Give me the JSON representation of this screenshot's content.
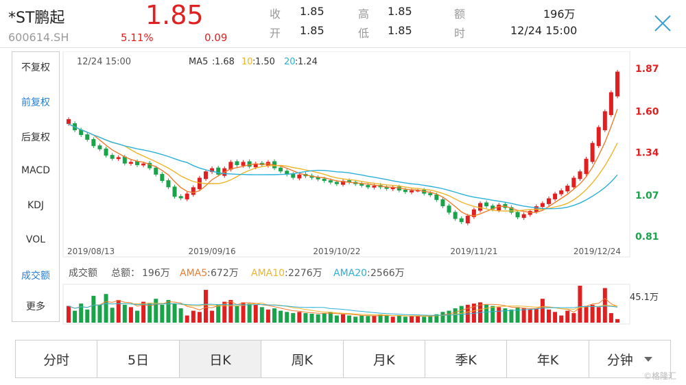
{
  "header": {
    "name": "*ST鹏起",
    "code": "600614.SH",
    "price": "1.85",
    "change_pct": "5.11%",
    "change_amt": "0.09",
    "quote": [
      {
        "label": "收",
        "value": "1.85"
      },
      {
        "label": "开",
        "value": "1.85"
      },
      {
        "label": "高",
        "value": "1.85"
      },
      {
        "label": "低",
        "value": "1.85"
      },
      {
        "label": "额",
        "value": "196万"
      },
      {
        "label": "时",
        "value": "12/24 15:00"
      }
    ]
  },
  "sidebar": {
    "items": [
      {
        "label": "不复权",
        "active": false
      },
      {
        "label": "前复权",
        "active": true
      },
      {
        "label": "后复权",
        "active": false
      },
      {
        "label": "MACD",
        "active": false
      },
      {
        "label": "KDJ",
        "active": false
      },
      {
        "label": "VOL",
        "active": false
      },
      {
        "label": "成交额",
        "active": true
      },
      {
        "label": "更多",
        "active": false
      }
    ]
  },
  "tabs": [
    {
      "label": "分时",
      "active": false
    },
    {
      "label": "5日",
      "active": false
    },
    {
      "label": "日K",
      "active": true
    },
    {
      "label": "周K",
      "active": false
    },
    {
      "label": "月K",
      "active": false
    },
    {
      "label": "季K",
      "active": false
    },
    {
      "label": "年K",
      "active": false
    },
    {
      "label": "分钟",
      "active": false,
      "dropdown": true
    }
  ],
  "colors": {
    "up": "#e02020",
    "down": "#1aa34a",
    "ma5": "#f07b2a",
    "ma10": "#f0b429",
    "ma20": "#2ab0d8",
    "active": "#2a7fd6"
  },
  "icons": {
    "close": "close-icon",
    "dropdown": "caret-down-icon"
  },
  "watermark": "©格隆汇",
  "chart_data": [
    {
      "type": "candlestick",
      "info_time": "12/24 15:00",
      "ma_legend": [
        {
          "name": "MA5",
          "value": "1.68"
        },
        {
          "name": "10",
          "value": "1.50"
        },
        {
          "name": "20",
          "value": "1.24"
        }
      ],
      "y_ticks": [
        "1.87",
        "1.60",
        "1.34",
        "1.07",
        "0.81"
      ],
      "ylim": [
        0.81,
        1.87
      ],
      "x_ticks": [
        {
          "label": "2019/08/13",
          "index": 0
        },
        {
          "label": "2019/09/16",
          "index": 23
        },
        {
          "label": "2019/10/22",
          "index": 43
        },
        {
          "label": "2019/11/21",
          "index": 65
        },
        {
          "label": "2019/12/24",
          "index": 88
        }
      ],
      "n": 89,
      "closes": [
        1.52,
        1.48,
        1.45,
        1.42,
        1.38,
        1.36,
        1.32,
        1.3,
        1.31,
        1.27,
        1.28,
        1.26,
        1.27,
        1.24,
        1.2,
        1.16,
        1.12,
        1.06,
        1.05,
        1.08,
        1.12,
        1.18,
        1.22,
        1.24,
        1.2,
        1.24,
        1.28,
        1.26,
        1.28,
        1.25,
        1.27,
        1.26,
        1.28,
        1.24,
        1.22,
        1.2,
        1.18,
        1.2,
        1.19,
        1.18,
        1.17,
        1.16,
        1.15,
        1.14,
        1.16,
        1.15,
        1.14,
        1.13,
        1.12,
        1.13,
        1.12,
        1.11,
        1.12,
        1.1,
        1.09,
        1.1,
        1.1,
        1.08,
        1.07,
        1.04,
        1.0,
        0.96,
        0.92,
        0.9,
        0.94,
        0.98,
        1.02,
        1.0,
        0.98,
        1.01,
        0.99,
        0.96,
        0.93,
        0.95,
        0.97,
        1.0,
        1.02,
        1.05,
        1.08,
        1.1,
        1.13,
        1.18,
        1.22,
        1.3,
        1.4,
        1.5,
        1.6,
        1.72,
        1.85
      ]
    },
    {
      "type": "bar",
      "title": "成交额",
      "total_label": "总额：",
      "total": "196万",
      "ama_legend": [
        {
          "name": "AMA5",
          "value": "672万"
        },
        {
          "name": "AMA10",
          "value": "2276万"
        },
        {
          "name": "AMA20",
          "value": "2566万"
        }
      ],
      "y_max_label": "45.1万",
      "values": [
        28,
        20,
        32,
        22,
        45,
        30,
        48,
        25,
        38,
        30,
        26,
        20,
        35,
        32,
        40,
        30,
        38,
        32,
        24,
        12,
        20,
        18,
        55,
        20,
        30,
        35,
        38,
        28,
        34,
        32,
        30,
        26,
        22,
        24,
        20,
        18,
        16,
        18,
        16,
        15,
        14,
        16,
        18,
        12,
        14,
        12,
        10,
        12,
        11,
        12,
        14,
        12,
        10,
        12,
        10,
        11,
        12,
        10,
        11,
        14,
        18,
        20,
        24,
        28,
        30,
        32,
        34,
        30,
        28,
        26,
        24,
        22,
        26,
        24,
        22,
        24,
        40,
        22,
        18,
        12,
        20,
        16,
        62,
        28,
        30,
        26,
        58,
        16,
        6
      ]
    }
  ]
}
